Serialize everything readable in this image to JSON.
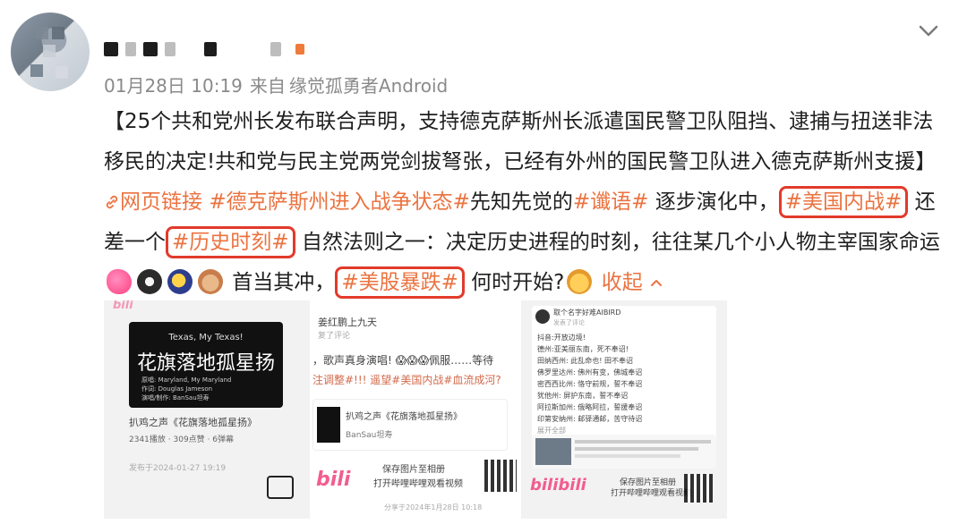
{
  "post": {
    "meta": {
      "date": "01月28日 10:19",
      "source_prefix": "来自",
      "source": "缘觉孤勇者Android"
    },
    "text": {
      "p1": "【25个共和党州长发布联合声明，支持德克萨斯州长派遣国民警卫队阻挡、逮捕与扭送非法移民的决定!共和党与民主党两党剑拔弩张，已经有外州的国民警卫队进入德克萨斯州支援】",
      "link": "网页链接",
      "tag1": "#德克萨斯州进入战争状态#",
      "p2": "先知先觉的",
      "tag2": "#谶语#",
      "p3": " 逐步演化中，",
      "tag3": "#美国内战#",
      "p4": " 还差一个",
      "tag4": "#历史时刻#",
      "p5": " 自然法则之一：决定历史进程的时刻，往往某几个小人物主宰国家命运",
      "p6": " 首当其冲，",
      "tag5": "#美股暴跌#",
      "p7": " 何时开始?",
      "collapse": "收起"
    }
  },
  "thumb1": {
    "line1": "Texas, My Texas!",
    "title": "花旗落地孤星扬",
    "l1": "原唱: Maryland, My Maryland",
    "l2": "作词: Douglas Jameson",
    "l3": "演唱/制作: BanSau坦寿",
    "video_title": "扒鸡之声《花旗落地孤星扬》",
    "stats": "2341播放 · 309点赞 · 6弹幕",
    "date": "发布于2024-01-27 19:19"
  },
  "thumb2": {
    "top1": "姜红鹏上九天",
    "top2": "复了评论",
    "line1": "，歌声真身演唱! 😱😱😱佩服……等待",
    "line2": "注调整#!!! 遥望#美国内战#血流成河?",
    "video_title": "扒鸡之声《花旗落地孤星扬》",
    "author": "BanSau坦寿",
    "save": "保存图片至相册",
    "open": "打开哔哩哔哩观看视频",
    "date": "分享于2024年1月28日 10:18"
  },
  "thumb3": {
    "user": "取个名字好难AIBIRD",
    "sub": "发表了评论",
    "lines": [
      "抖音:开放边境!",
      "德州:亚美丽东南，死不奉诏!",
      "田纳西州: 此乱命也! 田不奉诏",
      "佛罗里达州: 佛州有变，佛城奉诏",
      "密西西比州: 恪守前规，誓不奉诏",
      "犹他州: 屏护东南，誓不奉诏",
      "阿拉斯加州: 俄略阿拉，誓援奉诏",
      "印第安纳州: 邮驿通邮，苦守待诏",
      "展开全部"
    ],
    "save": "保存图片至相册",
    "open": "打开哔哩哔哩观看视频"
  }
}
